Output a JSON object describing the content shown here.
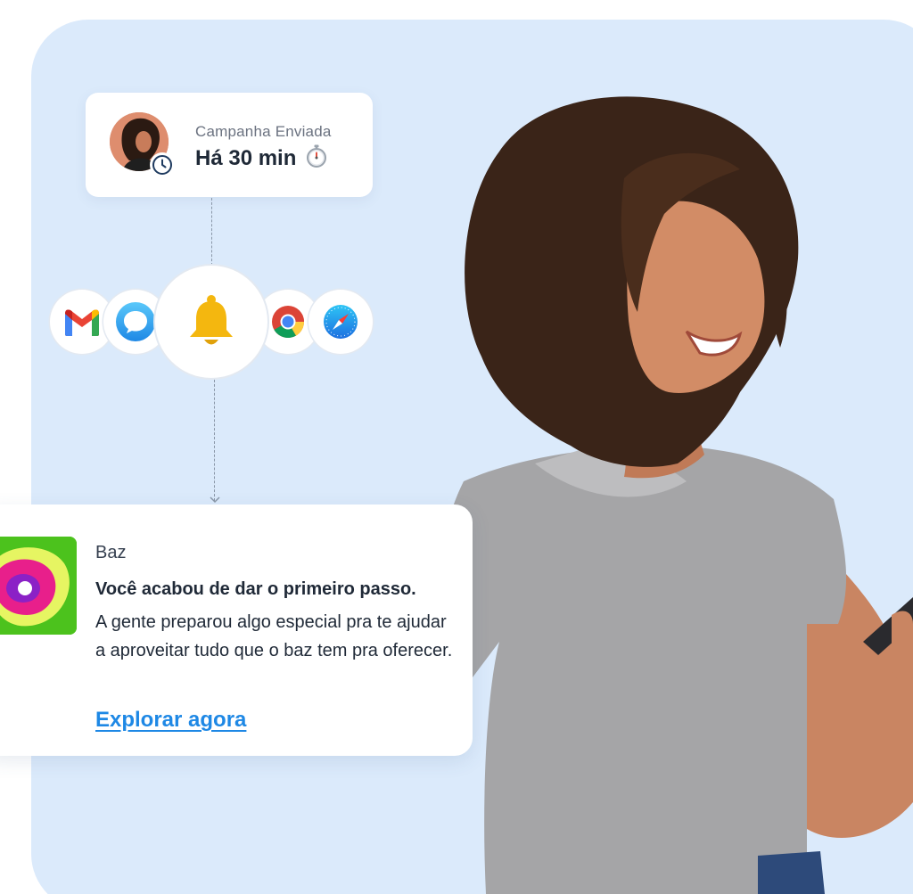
{
  "campaign": {
    "subtitle": "Campanha Enviada",
    "time": "Há 30 min",
    "avatar_icon": "avatar-woman",
    "badge_icon": "clock-icon",
    "time_icon": "stopwatch-icon"
  },
  "channels": [
    {
      "name": "gmail",
      "icon": "gmail-icon"
    },
    {
      "name": "messages",
      "icon": "chat-bubble-icon"
    },
    {
      "name": "push",
      "icon": "bell-icon",
      "color": "#f4b70f"
    },
    {
      "name": "chrome",
      "icon": "chrome-icon"
    },
    {
      "name": "safari",
      "icon": "safari-icon"
    }
  ],
  "notification": {
    "app_name": "Baz",
    "title": "Você acabou de dar o primeiro passo.",
    "body": "A gente preparou algo especial pra te ajudar a aproveitar tudo que o baz tem pra oferecer.",
    "cta": "Explorar agora",
    "logo_colors": [
      "#4cc21d",
      "#e6f562",
      "#e81f8b",
      "#8b21c6"
    ]
  },
  "colors": {
    "background_panel": "#dbeafb",
    "link": "#1e88e5",
    "text_dark": "#1f2937",
    "text_muted": "#6b7280"
  }
}
